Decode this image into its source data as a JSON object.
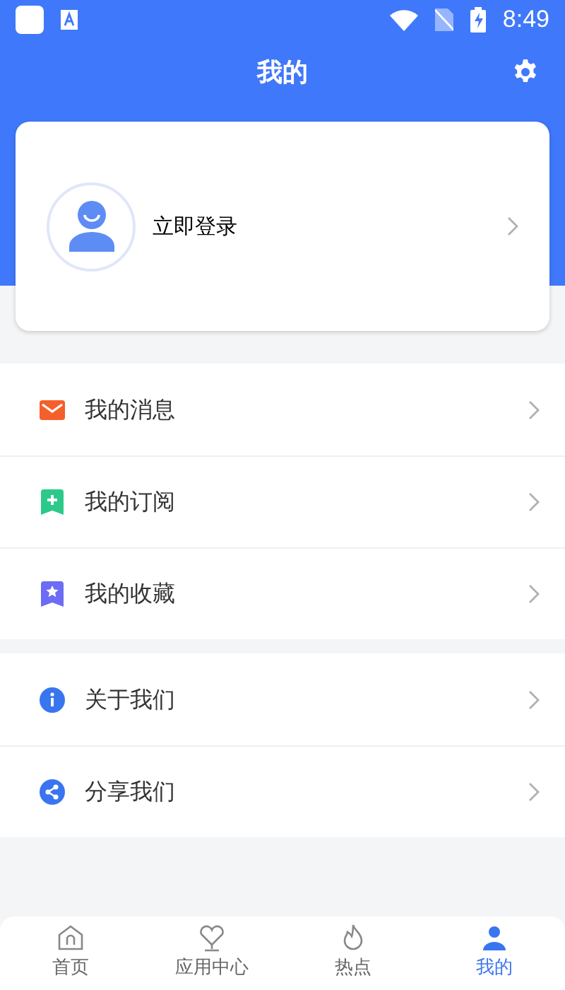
{
  "status_bar": {
    "time": "8:49"
  },
  "header": {
    "title": "我的"
  },
  "profile": {
    "login": "立即登录"
  },
  "menu_groups": [
    {
      "items": [
        {
          "kind": "message",
          "label": "我的消息"
        },
        {
          "kind": "subscribe",
          "label": "我的订阅"
        },
        {
          "kind": "favorite",
          "label": "我的收藏"
        }
      ]
    },
    {
      "items": [
        {
          "kind": "about",
          "label": "关于我们"
        },
        {
          "kind": "share",
          "label": "分享我们"
        }
      ]
    }
  ],
  "bottom_nav": [
    {
      "kind": "home",
      "label": "首页",
      "selected": false
    },
    {
      "kind": "apps",
      "label": "应用中心",
      "selected": false
    },
    {
      "kind": "hot",
      "label": "热点",
      "selected": false
    },
    {
      "kind": "me",
      "label": "我的",
      "selected": true
    }
  ]
}
